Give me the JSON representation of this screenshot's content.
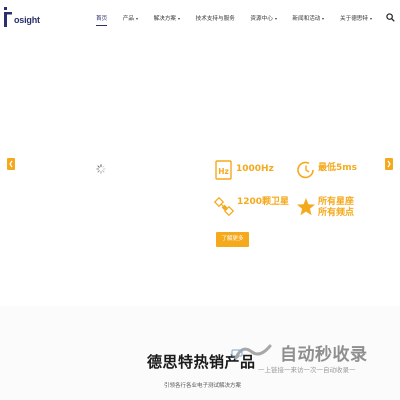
{
  "header": {
    "logo_text": "osight",
    "nav": [
      {
        "label": "首页",
        "active": true,
        "dropdown": false
      },
      {
        "label": "产品",
        "active": false,
        "dropdown": true
      },
      {
        "label": "解决方案",
        "active": false,
        "dropdown": true
      },
      {
        "label": "技术支持与服务",
        "active": false,
        "dropdown": false
      },
      {
        "label": "资源中心",
        "active": false,
        "dropdown": true
      },
      {
        "label": "新闻和活动",
        "active": false,
        "dropdown": true
      },
      {
        "label": "关于德思特",
        "active": false,
        "dropdown": true
      }
    ],
    "search_icon": "search-icon"
  },
  "hero": {
    "features": [
      {
        "text": "1000Hz",
        "icon": "hz-icon"
      },
      {
        "text": "最低5ms",
        "icon": "clock-icon"
      },
      {
        "text": "1200颗卫星",
        "icon": "satellite-icon"
      },
      {
        "text_lines": [
          "所有星座",
          "所有频点"
        ],
        "icon": "star-icon"
      }
    ],
    "cta_label": "了解更多",
    "loading_icon": "loading-spinner-icon",
    "accent_color": "#f5a91c"
  },
  "products": {
    "title": "德思特热销产品",
    "subtitle": "引领各行各业电子测试解决方案"
  },
  "watermark": {
    "main": "自动秒收录",
    "sub": "一上链接一来访一次一自动收录一"
  },
  "colors": {
    "brand": "#2b2f6b",
    "accent": "#f5a91c",
    "text": "#333333"
  }
}
